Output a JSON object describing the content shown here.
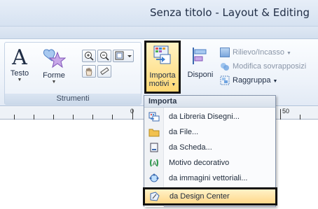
{
  "window": {
    "title": "Senza titolo - Layout & Editing"
  },
  "ribbon": {
    "group_strumenti": {
      "label": "Strumenti",
      "testo_label": "Testo",
      "forme_label": "Forme"
    },
    "importa_line1": "Importa",
    "importa_line2": "motivi",
    "disponi_label": "Disponi",
    "rilievo_label": "Rilievo/Incasso",
    "modifica_label": "Modifica sovrapposizi",
    "raggruppa_label": "Raggruppa"
  },
  "ruler": {
    "labels": [
      "0",
      "50"
    ]
  },
  "menu": {
    "header": "Importa",
    "items": [
      {
        "label": "da Libreria Disegni...",
        "icon": "design-library-icon"
      },
      {
        "label": "da File...",
        "icon": "folder-icon"
      },
      {
        "label": "da Scheda...",
        "icon": "card-icon"
      },
      {
        "label": "Motivo decorativo",
        "icon": "decorative-pattern-icon"
      },
      {
        "label": "da immagini vettoriali...",
        "icon": "vector-image-icon"
      },
      {
        "label": "da Design Center",
        "icon": "design-center-icon",
        "selected": true
      }
    ]
  },
  "colors": {
    "ribbon_bg": "#eef3fa",
    "highlight": "#ffd88a",
    "selection_border": "#111111"
  }
}
